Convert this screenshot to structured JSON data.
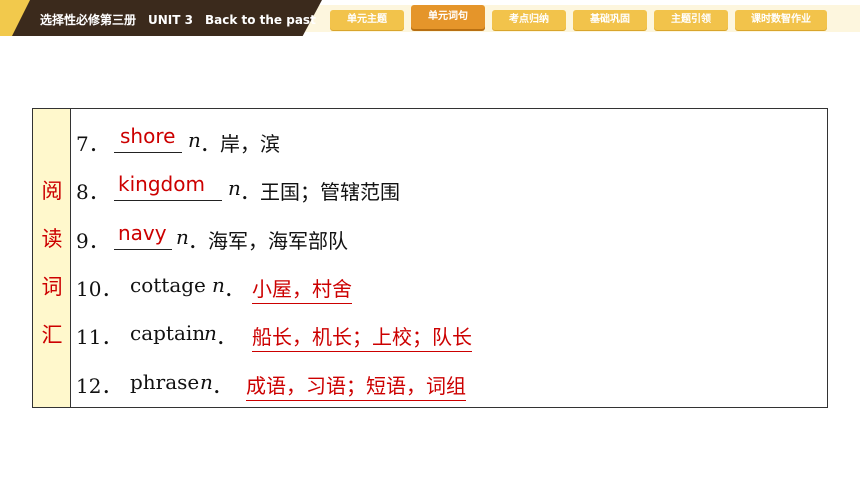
{
  "header": {
    "title": "选择性必修第三册　UNIT 3　Back to the past",
    "tabs": [
      {
        "label": "单元主题",
        "active": false
      },
      {
        "label": "单元词句",
        "active": true
      },
      {
        "label": "考点归纳",
        "active": false
      },
      {
        "label": "基础巩固",
        "active": false
      },
      {
        "label": "主题引领",
        "active": false
      },
      {
        "label": "课时数智作业",
        "active": false
      }
    ],
    "colors": {
      "tab": "#f2c34b",
      "tab_active": "#e5952a",
      "banner": "#3b2a1c"
    }
  },
  "vocab": {
    "side_label": [
      "阅",
      "读",
      "词",
      "汇"
    ],
    "items": [
      {
        "num": "7．",
        "answer": "shore",
        "pos": "n",
        "meaning": "．岸，滨"
      },
      {
        "num": "8．",
        "answer": "kingdom",
        "pos": "n",
        "meaning": "．王国；管辖范围"
      },
      {
        "num": "9．",
        "answer": "navy",
        "pos": "n",
        "meaning": "．海军，海军部队"
      },
      {
        "num": "10．",
        "word": "cottage",
        "pos": "n",
        "sep": "．",
        "answer": "小屋，村舍"
      },
      {
        "num": "11．",
        "word": "captain",
        "pos": "n",
        "sep": "．",
        "answer": "船长，机长；上校；队长"
      },
      {
        "num": "12．",
        "word": "phrase",
        "pos": "n",
        "sep": "．",
        "answer": "成语，习语；短语，词组"
      }
    ],
    "answer_color": "#cc0000"
  }
}
